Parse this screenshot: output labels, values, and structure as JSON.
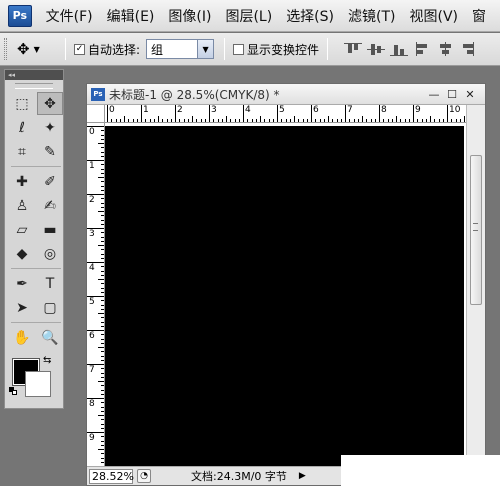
{
  "app": {
    "logo_text": "Ps"
  },
  "menu": {
    "items": [
      "文件(F)",
      "编辑(E)",
      "图像(I)",
      "图层(L)",
      "选择(S)",
      "滤镜(T)",
      "视图(V)",
      "窗"
    ]
  },
  "options": {
    "auto_select_label": "自动选择:",
    "auto_select_checked": true,
    "auto_select_value": "组",
    "show_transform_label": "显示变换控件",
    "show_transform_checked": false
  },
  "toolbox": {
    "collapse_label": "◂◂",
    "tools": [
      {
        "name": "marquee",
        "glyph": "⬚",
        "active": false
      },
      {
        "name": "move",
        "glyph": "✥",
        "active": true
      },
      {
        "name": "lasso",
        "glyph": "ℓ",
        "active": false
      },
      {
        "name": "magic-wand",
        "glyph": "✦",
        "active": false
      },
      {
        "name": "crop",
        "glyph": "⌗",
        "active": false
      },
      {
        "name": "eyedropper",
        "glyph": "✎",
        "active": false
      },
      {
        "name": "healing",
        "glyph": "✚",
        "active": false
      },
      {
        "name": "brush",
        "glyph": "✐",
        "active": false
      },
      {
        "name": "stamp",
        "glyph": "♙",
        "active": false
      },
      {
        "name": "history-brush",
        "glyph": "✍",
        "active": false
      },
      {
        "name": "eraser",
        "glyph": "▱",
        "active": false
      },
      {
        "name": "gradient",
        "glyph": "▬",
        "active": false
      },
      {
        "name": "blur",
        "glyph": "◆",
        "active": false
      },
      {
        "name": "dodge",
        "glyph": "◎",
        "active": false
      },
      {
        "name": "pen",
        "glyph": "✒",
        "active": false
      },
      {
        "name": "type",
        "glyph": "T",
        "active": false
      },
      {
        "name": "path-select",
        "glyph": "➤",
        "active": false
      },
      {
        "name": "shape",
        "glyph": "▢",
        "active": false
      },
      {
        "name": "hand",
        "glyph": "✋",
        "active": false
      },
      {
        "name": "zoom",
        "glyph": "🔍",
        "active": false
      }
    ],
    "foreground_color": "#000000",
    "background_color": "#ffffff"
  },
  "document": {
    "icon_text": "Ps",
    "title": "未标题-1 @ 28.5%(CMYK/8) *",
    "controls": [
      "—",
      "☐",
      "✕"
    ],
    "ruler_h_labels": [
      "0",
      "1",
      "2",
      "3",
      "4",
      "5",
      "6",
      "7",
      "8",
      "9",
      "10"
    ],
    "ruler_v_labels": [
      "0",
      "1",
      "2",
      "3",
      "4",
      "5",
      "6",
      "7",
      "8",
      "9"
    ],
    "canvas_color": "#000000",
    "zoom": "28.52%",
    "status": "文档:24.3M/0 字节"
  }
}
